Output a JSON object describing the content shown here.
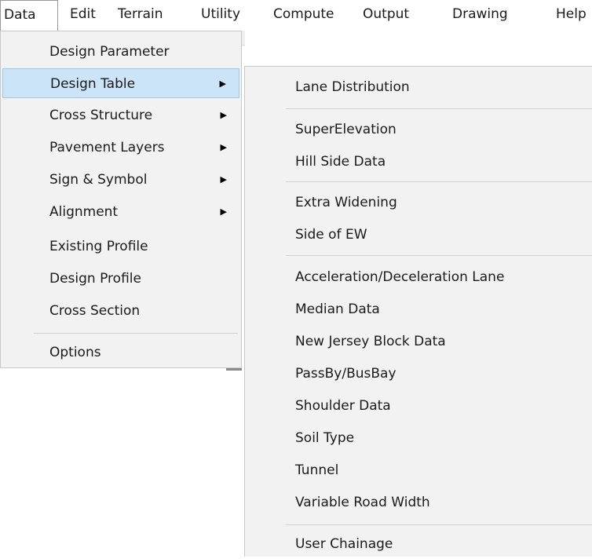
{
  "menubar": {
    "items": [
      "Data",
      "Edit",
      "Terrain",
      "Utility",
      "Compute",
      "Output",
      "Drawing",
      "Help"
    ]
  },
  "primary_menu": {
    "items": [
      {
        "label": "Design Parameter",
        "has_submenu": false
      },
      {
        "label": "Design Table",
        "has_submenu": true
      },
      {
        "label": "Cross Structure",
        "has_submenu": true
      },
      {
        "label": "Pavement Layers",
        "has_submenu": true
      },
      {
        "label": "Sign & Symbol",
        "has_submenu": true
      },
      {
        "label": "Alignment",
        "has_submenu": true
      },
      {
        "label": "Existing Profile",
        "has_submenu": false
      },
      {
        "label": "Design Profile",
        "has_submenu": false
      },
      {
        "label": "Cross Section",
        "has_submenu": false
      },
      {
        "label": "Options",
        "has_submenu": false
      }
    ],
    "highlighted": "Design Table"
  },
  "submenu": {
    "items": [
      "Lane Distribution",
      "SuperElevation",
      "Hill Side Data",
      "Extra Widening",
      "Side of EW",
      "Acceleration/Deceleration Lane",
      "Median Data",
      "New Jersey Block Data",
      "PassBy/BusBay",
      "Shoulder Data",
      "Soil Type",
      "Tunnel",
      "Variable Road Width",
      "User Chainage"
    ]
  },
  "icons": {
    "submenu_arrow": "submenu-arrow-icon"
  },
  "colors": {
    "highlight_bg": "#cce4f7",
    "highlight_border": "#99c9ef",
    "menu_bg": "#f2f2f2"
  }
}
